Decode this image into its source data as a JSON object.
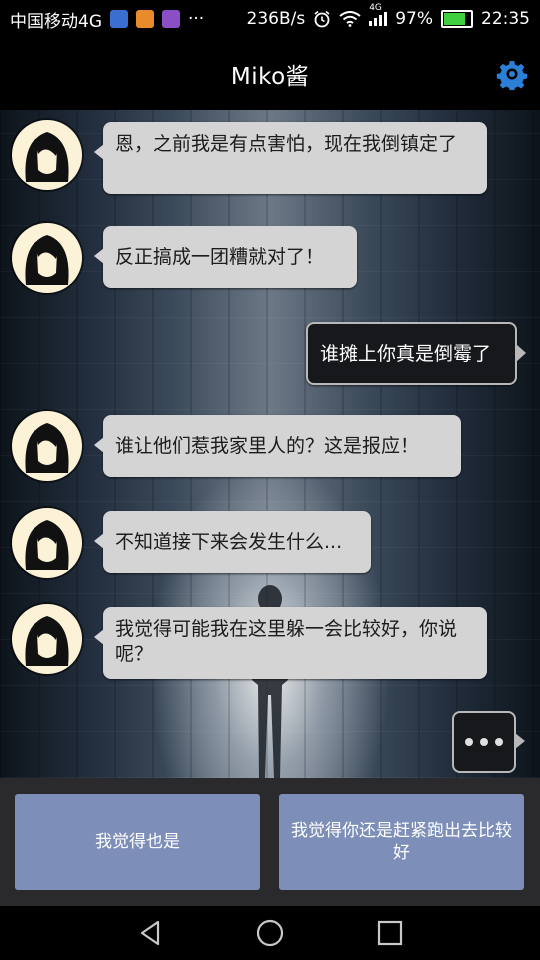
{
  "status_bar": {
    "carrier": "中国移动4G",
    "icons": [
      "app-icon-blue",
      "app-icon-orange",
      "app-icon-purple"
    ],
    "more": "···",
    "speed": "236B/s",
    "signal_label": "4G",
    "battery_percent": "97%",
    "battery_level": 0.97,
    "time": "22:35"
  },
  "header": {
    "title": "Miko酱",
    "settings_icon": "gear-icon"
  },
  "messages": [
    {
      "side": "left",
      "text": "恩，之前我是有点害怕，现在我倒镇定了"
    },
    {
      "side": "left",
      "text": "反正搞成一团糟就对了！"
    },
    {
      "side": "right",
      "text": "谁摊上你真是倒霉了"
    },
    {
      "side": "left",
      "text": "谁让他们惹我家里人的？这是报应！"
    },
    {
      "side": "left",
      "text": "不知道接下来会发生什么..."
    },
    {
      "side": "left",
      "text": "我觉得可能我在这里躲一会比较好，你说呢？"
    }
  ],
  "typing_indicator": "···",
  "choices": [
    {
      "label": "我觉得也是"
    },
    {
      "label": "我觉得你还是赶紧跑出去比较好"
    }
  ],
  "colors": {
    "choice_bg": "#7d8fb8",
    "bubble_left_bg": "#d4d4d4",
    "bubble_right_bg": "#17181c",
    "settings_icon": "#2b7fd6"
  },
  "nav": [
    "back-icon",
    "home-icon",
    "recents-icon"
  ]
}
